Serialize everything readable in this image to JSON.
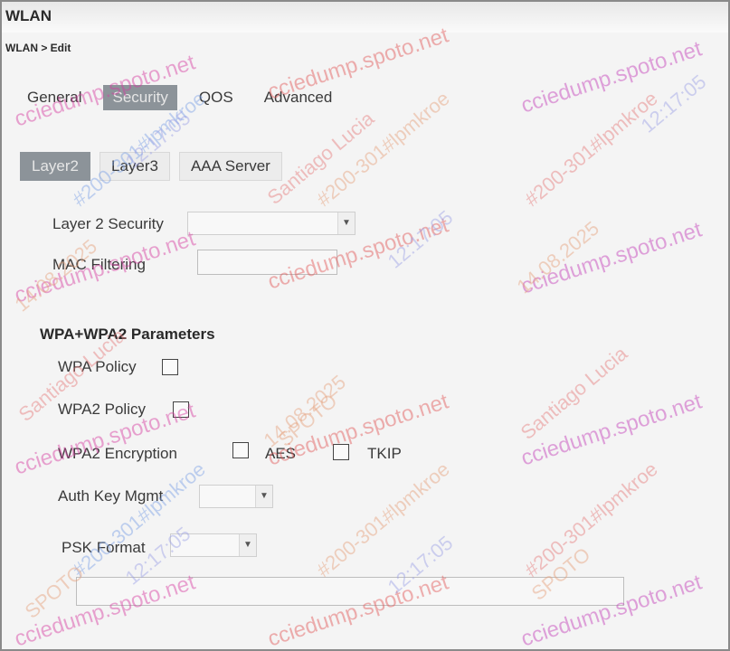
{
  "window": {
    "title": "WLAN",
    "breadcrumb": "WLAN > Edit"
  },
  "tabs": [
    {
      "label": "General",
      "active": false
    },
    {
      "label": "Security",
      "active": true
    },
    {
      "label": "QOS",
      "active": false
    },
    {
      "label": "Advanced",
      "active": false
    }
  ],
  "subtabs": [
    {
      "label": "Layer2",
      "active": true
    },
    {
      "label": "Layer3",
      "active": false
    },
    {
      "label": "AAA Server",
      "active": false
    }
  ],
  "form": {
    "layer2_security": {
      "label": "Layer 2 Security",
      "value": ""
    },
    "mac_filtering": {
      "label": "MAC Filtering",
      "checked": false
    },
    "wpa_section": {
      "heading": "WPA+WPA2 Parameters"
    },
    "wpa_policy": {
      "label": "WPA Policy",
      "checked": false
    },
    "wpa2_policy": {
      "label": "WPA2 Policy",
      "checked": false
    },
    "wpa2_encryption": {
      "label": "WPA2 Encryption",
      "aes_label": "AES",
      "aes_checked": false,
      "tkip_label": "TKIP",
      "tkip_checked": false
    },
    "auth_key_mgmt": {
      "label": "Auth Key Mgmt",
      "value": ""
    },
    "psk_format": {
      "label": "PSK Format",
      "value": ""
    },
    "psk_value": ""
  },
  "colors": {
    "active_tab": "#8c9399",
    "panel": "#f4f4f4"
  },
  "watermark": {
    "site": "cciedump.spoto.net",
    "id": "#200-301#lpmkroe",
    "date": "14.08.2025",
    "time": "12:17:05",
    "name": "Santiago Lucia",
    "brand": "SPOTO"
  }
}
